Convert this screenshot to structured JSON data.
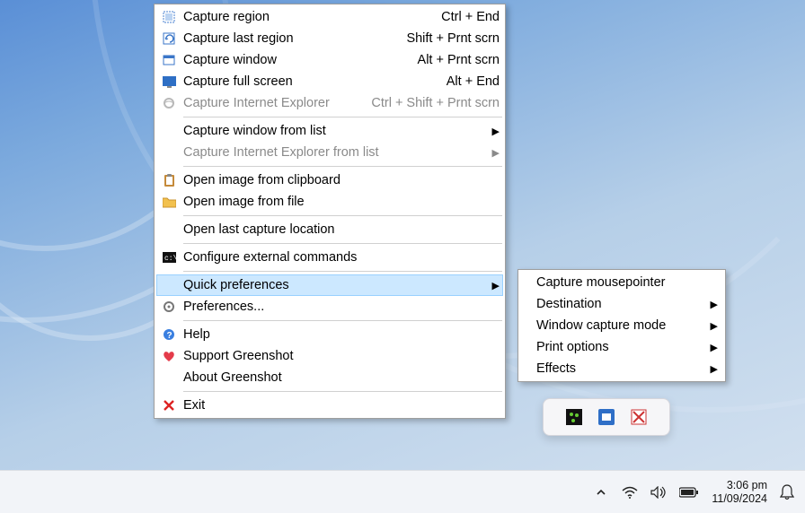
{
  "menu": {
    "capture_region": {
      "label": "Capture region",
      "accel": "Ctrl + End"
    },
    "capture_last_region": {
      "label": "Capture last region",
      "accel": "Shift + Prnt scrn"
    },
    "capture_window": {
      "label": "Capture window",
      "accel": "Alt + Prnt scrn"
    },
    "capture_full_screen": {
      "label": "Capture full screen",
      "accel": "Alt + End"
    },
    "capture_ie": {
      "label": "Capture Internet Explorer",
      "accel": "Ctrl + Shift + Prnt scrn"
    },
    "capture_window_list": {
      "label": "Capture window from list"
    },
    "capture_ie_list": {
      "label": "Capture Internet Explorer from list"
    },
    "open_clipboard": {
      "label": "Open image from clipboard"
    },
    "open_file": {
      "label": "Open image from file"
    },
    "open_last_location": {
      "label": "Open last capture location"
    },
    "configure_external": {
      "label": "Configure external commands"
    },
    "quick_preferences": {
      "label": "Quick preferences"
    },
    "preferences": {
      "label": "Preferences..."
    },
    "help": {
      "label": "Help"
    },
    "support": {
      "label": "Support Greenshot"
    },
    "about": {
      "label": "About Greenshot"
    },
    "exit": {
      "label": "Exit"
    }
  },
  "submenu": {
    "capture_mousepointer": {
      "label": "Capture mousepointer"
    },
    "destination": {
      "label": "Destination"
    },
    "window_capture_mode": {
      "label": "Window capture mode"
    },
    "print_options": {
      "label": "Print options"
    },
    "effects": {
      "label": "Effects"
    }
  },
  "taskbar": {
    "time": "3:06 pm",
    "date": "11/09/2024"
  }
}
